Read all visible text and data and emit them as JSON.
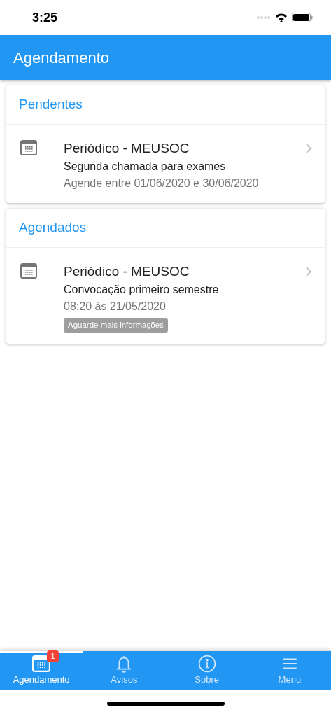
{
  "status_bar": {
    "time": "3:25"
  },
  "header": {
    "title": "Agendamento"
  },
  "sections": [
    {
      "title": "Pendentes",
      "items": [
        {
          "title": "Periódico - MEUSOC",
          "subtitle": "Segunda chamada para exames",
          "detail": "Agende entre 01/06/2020 e 30/06/2020"
        }
      ]
    },
    {
      "title": "Agendados",
      "items": [
        {
          "title": "Periódico - MEUSOC",
          "subtitle": "Convocação primeiro semestre",
          "detail": "08:20 às 21/05/2020",
          "tag": "Aguarde mais informações"
        }
      ]
    }
  ],
  "tabs": [
    {
      "kind": "calendar",
      "label": "Agendamento",
      "selected": true,
      "badge": "1"
    },
    {
      "kind": "bell",
      "label": "Avisos",
      "selected": false
    },
    {
      "kind": "info",
      "label": "Sobre",
      "selected": false
    },
    {
      "kind": "menu",
      "label": "Menu",
      "selected": false
    }
  ]
}
